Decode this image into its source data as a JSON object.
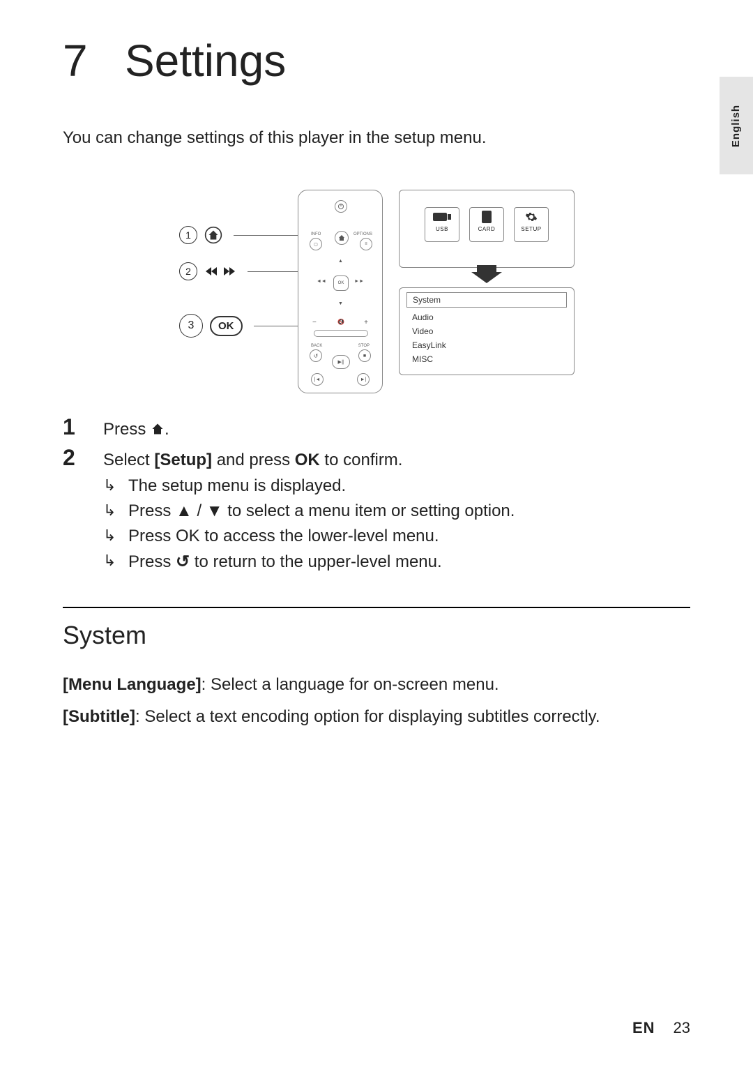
{
  "side_tab": "English",
  "chapter": {
    "number": "7",
    "title": "Settings"
  },
  "intro": "You can change settings of this player in the setup menu.",
  "diagram": {
    "labels": {
      "l1_icon": "home-icon",
      "l2_icons": "rewind-forward-icon",
      "l3_text": "OK"
    },
    "remote": {
      "info": "INFO",
      "options": "OPTIONS",
      "ok": "OK",
      "back": "BACK",
      "stop": "STOP"
    },
    "top_tiles": {
      "usb": "USB",
      "card": "CARD",
      "setup": "SETUP"
    },
    "menu_items": [
      "System",
      "Audio",
      "Video",
      "EasyLink",
      "MISC"
    ]
  },
  "steps": {
    "s1_prefix": "Press ",
    "s1_suffix": ".",
    "s2_a": "Select ",
    "s2_b": "[Setup]",
    "s2_c": " and press ",
    "s2_d": "OK",
    "s2_e": " to confirm.",
    "sub1": "The setup menu is displayed.",
    "sub2_a": "Press ",
    "sub2_b": " to select a menu item or setting option.",
    "sub3_a": "Press ",
    "sub3_b": "OK",
    "sub3_c": " to access the lower-level menu.",
    "sub4_a": "Press ",
    "sub4_b": " to return to the upper-level menu."
  },
  "section_system": {
    "heading": "System",
    "menu_language_label": "[Menu Language]",
    "menu_language_desc": ": Select a language for on-screen menu.",
    "subtitle_label": "[Subtitle]",
    "subtitle_desc": ": Select a text encoding option for displaying subtitles correctly."
  },
  "footer": {
    "lang": "EN",
    "page": "23"
  }
}
